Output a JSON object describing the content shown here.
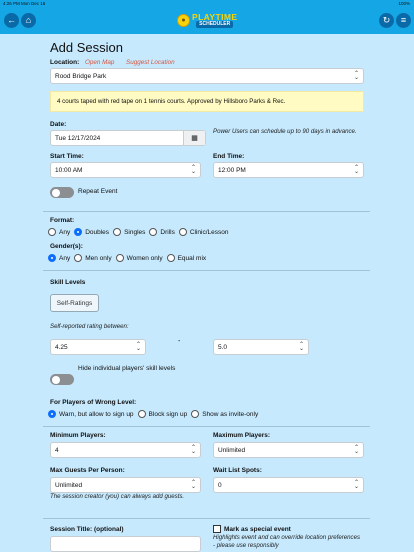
{
  "status": {
    "time": "4:26 PM   Mon Dec 16",
    "right": "100%"
  },
  "header": {
    "back_icon": "←",
    "home_icon": "⌂",
    "refresh_icon": "↻",
    "menu_icon": "≡",
    "logo_top": "PLAYTIME",
    "logo_bottom": "SCHEDULER"
  },
  "title": "Add Session",
  "location": {
    "label": "Location:",
    "open_map": "Open Map",
    "suggest": "Suggest Location",
    "value": "Rood Bridge Park",
    "note": "4 courts taped with red tape on 1 tennis courts. Approved by Hillsboro Parks & Rec."
  },
  "date": {
    "label": "Date:",
    "value": "Tue 12/17/2024",
    "note": "Power Users can schedule up to 90 days in advance."
  },
  "start": {
    "label": "Start Time:",
    "value": "10:00 AM"
  },
  "end": {
    "label": "End Time:",
    "value": "12:00 PM"
  },
  "repeat": {
    "label": "Repeat Event"
  },
  "format": {
    "label": "Format:",
    "options": [
      "Any",
      "Doubles",
      "Singles",
      "Drills",
      "Clinic/Lesson"
    ],
    "selected": "Doubles"
  },
  "gender": {
    "label": "Gender(s):",
    "options": [
      "Any",
      "Men only",
      "Women only",
      "Equal mix"
    ],
    "selected": "Any"
  },
  "skill": {
    "label": "Skill Levels",
    "button": "Self-Ratings",
    "range_label": "Self-reported rating between:",
    "min": "4.25",
    "dash": "-",
    "max": "5.0",
    "hide_label": "Hide individual players' skill levels"
  },
  "wrong_level": {
    "label": "For Players of Wrong Level:",
    "options": [
      "Warn, but allow to sign up",
      "Block sign up",
      "Show as invite-only"
    ],
    "selected": "Warn, but allow to sign up"
  },
  "min_players": {
    "label": "Minimum Players:",
    "value": "4"
  },
  "max_players": {
    "label": "Maximum Players:",
    "value": "Unlimited"
  },
  "guests": {
    "label": "Max Guests Per Person:",
    "value": "Unlimited",
    "note": "The session creator (you) can always add guests."
  },
  "waitlist": {
    "label": "Wait List Spots:",
    "value": "0"
  },
  "session_title": {
    "label": "Session Title: (optional)",
    "value": ""
  },
  "special": {
    "label": "Mark as special event",
    "note": "Highlights event and can override location preferences - please use responsibly"
  }
}
